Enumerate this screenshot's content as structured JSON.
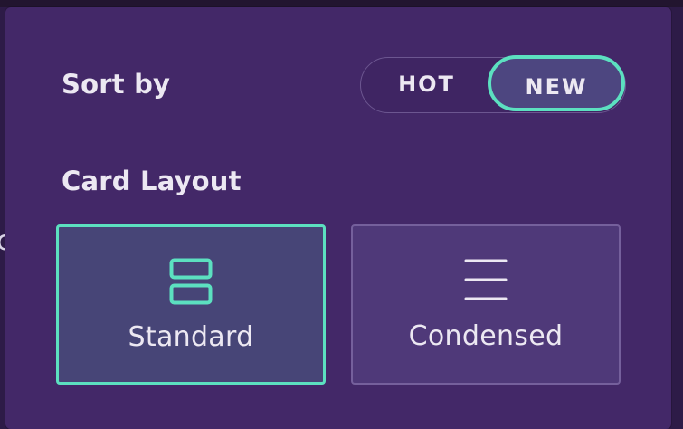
{
  "sort": {
    "label": "Sort by",
    "options": [
      {
        "label": "HOT",
        "selected": false
      },
      {
        "label": "NEW",
        "selected": true
      }
    ]
  },
  "layout": {
    "label": "Card Layout",
    "options": [
      {
        "label": "Standard",
        "icon": "standard-layout-icon",
        "selected": true
      },
      {
        "label": "Condensed",
        "icon": "condensed-layout-icon",
        "selected": false
      }
    ]
  },
  "colors": {
    "panel": "#432868",
    "accent": "#5ce0c0",
    "text": "#ece8f2"
  }
}
